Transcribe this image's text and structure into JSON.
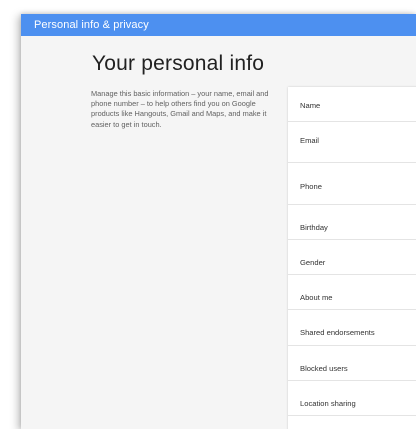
{
  "header": {
    "title": "Personal info & privacy"
  },
  "main": {
    "title": "Your personal info",
    "description": "Manage this basic information – your name, email and phone number – to help others find you on Google products like Hangouts, Gmail and Maps, and make it easier to get in touch."
  },
  "settings": {
    "rows": [
      {
        "label": "Name"
      },
      {
        "label": "Email"
      },
      {
        "label": "Phone"
      },
      {
        "label": "Birthday"
      },
      {
        "label": "Gender"
      },
      {
        "label": "About me"
      },
      {
        "label": "Shared endorsements"
      },
      {
        "label": "Blocked users"
      },
      {
        "label": "Location sharing"
      }
    ]
  },
  "colors": {
    "topbar": "#4d90f0",
    "background": "#f5f5f5",
    "panel": "#ffffff"
  }
}
